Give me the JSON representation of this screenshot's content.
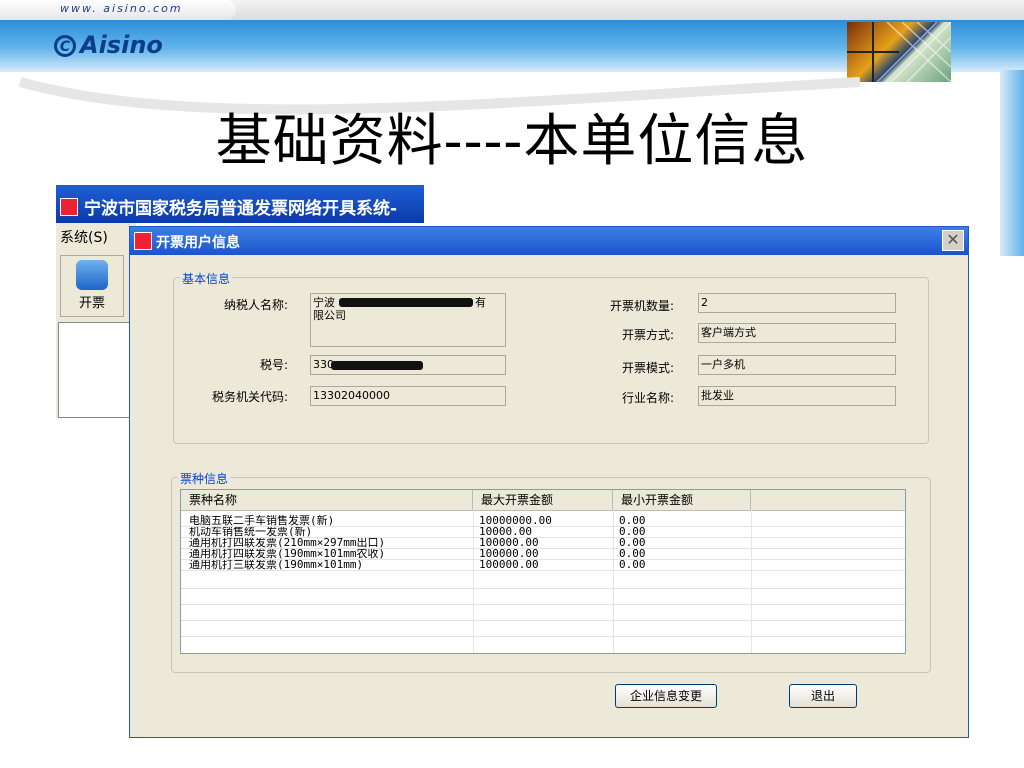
{
  "slide": {
    "url": "www. aisino.com",
    "brand": "Aisino",
    "title": "基础资料----本单位信息"
  },
  "bg_window": {
    "title": "宁波市国家税务局普通发票网络开具系统-",
    "menu_system": "系统(S)",
    "tool_invoice": "开票"
  },
  "dialog": {
    "title": "开票用户信息",
    "close_icon": "close-icon",
    "basic_info": {
      "legend": "基本信息",
      "taxpayer_name_label": "纳税人名称:",
      "taxpayer_name_line1_prefix": "宁波",
      "taxpayer_name_line1_suffix": "有",
      "taxpayer_name_line2": "限公司",
      "tax_no_label": "税号:",
      "tax_no_prefix": "330",
      "tax_office_code_label": "税务机关代码:",
      "tax_office_code": "13302040000",
      "machine_count_label": "开票机数量:",
      "machine_count": "2",
      "issue_method_label": "开票方式:",
      "issue_method": "客户端方式",
      "issue_mode_label": "开票模式:",
      "issue_mode": "一户多机",
      "industry_label": "行业名称:",
      "industry": "批发业"
    },
    "ticket_types": {
      "legend": "票种信息",
      "columns": [
        "票种名称",
        "最大开票金额",
        "最小开票金额"
      ],
      "rows": [
        {
          "name": "电脑五联二手车销售发票(新)",
          "max": "10000000.00",
          "min": "0.00"
        },
        {
          "name": "机动车销售统一发票(新)",
          "max": "10000.00",
          "min": "0.00"
        },
        {
          "name": "通用机打四联发票(210mm×297mm出口)",
          "max": "100000.00",
          "min": "0.00"
        },
        {
          "name": "通用机打四联发票(190mm×101mm农收)",
          "max": "100000.00",
          "min": "0.00"
        },
        {
          "name": "通用机打三联发票(190mm×101mm)",
          "max": "100000.00",
          "min": "0.00"
        }
      ]
    },
    "buttons": {
      "change_info": "企业信息变更",
      "exit": "退出"
    }
  }
}
